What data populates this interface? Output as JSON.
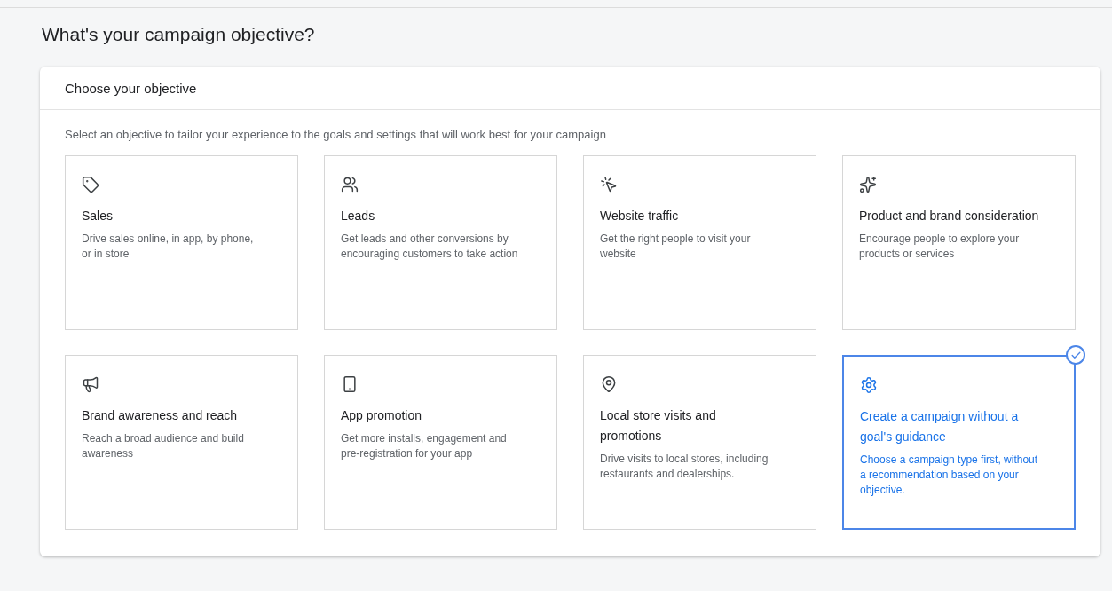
{
  "page_title": "What's your campaign objective?",
  "panel": {
    "title": "Choose your objective",
    "subtitle": "Select an objective to tailor your experience to the goals and settings that will work best for your campaign",
    "objectives": [
      {
        "kind": "tag",
        "title": "Sales",
        "description": "Drive sales online, in app, by phone, or in store",
        "selected": false
      },
      {
        "kind": "people",
        "title": "Leads",
        "description": "Get leads and other conversions by encouraging customers to take action",
        "selected": false
      },
      {
        "kind": "cursor",
        "title": "Website traffic",
        "description": "Get the right people to visit your website",
        "selected": false
      },
      {
        "kind": "sparkle",
        "title": "Product and brand consideration",
        "description": "Encourage people to explore your products or services",
        "selected": false
      },
      {
        "kind": "megaphone",
        "title": "Brand awareness and reach",
        "description": "Reach a broad audience and build awareness",
        "selected": false
      },
      {
        "kind": "phone",
        "title": "App promotion",
        "description": "Get more installs, engagement and pre-registration for your app",
        "selected": false
      },
      {
        "kind": "pin",
        "title": "Local store visits and promotions",
        "description": "Drive visits to local stores, including restaurants and dealerships.",
        "selected": false
      },
      {
        "kind": "gear",
        "title": "Create a campaign without a goal's guidance",
        "description": "Choose a campaign type first, without a recommendation based on your objective.",
        "selected": true
      }
    ]
  }
}
